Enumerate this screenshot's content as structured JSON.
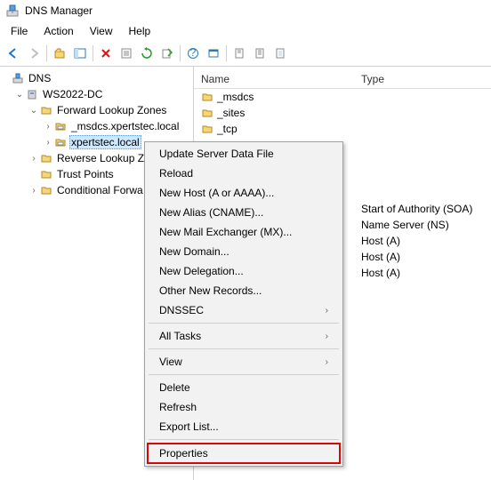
{
  "title": "DNS Manager",
  "menus": [
    "File",
    "Action",
    "View",
    "Help"
  ],
  "tree": {
    "root_label": "DNS",
    "server_label": "WS2022-DC",
    "nodes": [
      {
        "label": "Forward Lookup Zones",
        "expanded": true,
        "children": [
          {
            "label": "_msdcs.xpertstec.local"
          },
          {
            "label": "xpertstec.local",
            "selected": true
          }
        ]
      },
      {
        "label": "Reverse Lookup Z"
      },
      {
        "label": "Trust Points"
      },
      {
        "label": "Conditional Forwa"
      }
    ]
  },
  "list": {
    "cols": {
      "name": "Name",
      "type": "Type"
    },
    "rows_visible": [
      {
        "name": "_msdcs",
        "type": ""
      },
      {
        "name": "_sites",
        "type": ""
      },
      {
        "name": "_tcp",
        "type": ""
      }
    ],
    "rows_partially_hidden_types": [
      "Start of Authority (SOA)",
      "Name Server (NS)",
      "Host (A)",
      "Host (A)",
      "Host (A)"
    ]
  },
  "context_menu": {
    "items": [
      {
        "label": "Update Server Data File"
      },
      {
        "label": "Reload"
      },
      {
        "label": "New Host (A or AAAA)..."
      },
      {
        "label": "New Alias (CNAME)..."
      },
      {
        "label": "New Mail Exchanger (MX)..."
      },
      {
        "label": "New Domain..."
      },
      {
        "label": "New Delegation..."
      },
      {
        "label": "Other New Records..."
      },
      {
        "label": "DNSSEC",
        "submenu": true
      },
      {
        "sep": true
      },
      {
        "label": "All Tasks",
        "submenu": true
      },
      {
        "sep": true
      },
      {
        "label": "View",
        "submenu": true
      },
      {
        "sep": true
      },
      {
        "label": "Delete"
      },
      {
        "label": "Refresh"
      },
      {
        "label": "Export List..."
      },
      {
        "sep": true
      },
      {
        "label": "Properties",
        "highlighted": true
      }
    ]
  }
}
